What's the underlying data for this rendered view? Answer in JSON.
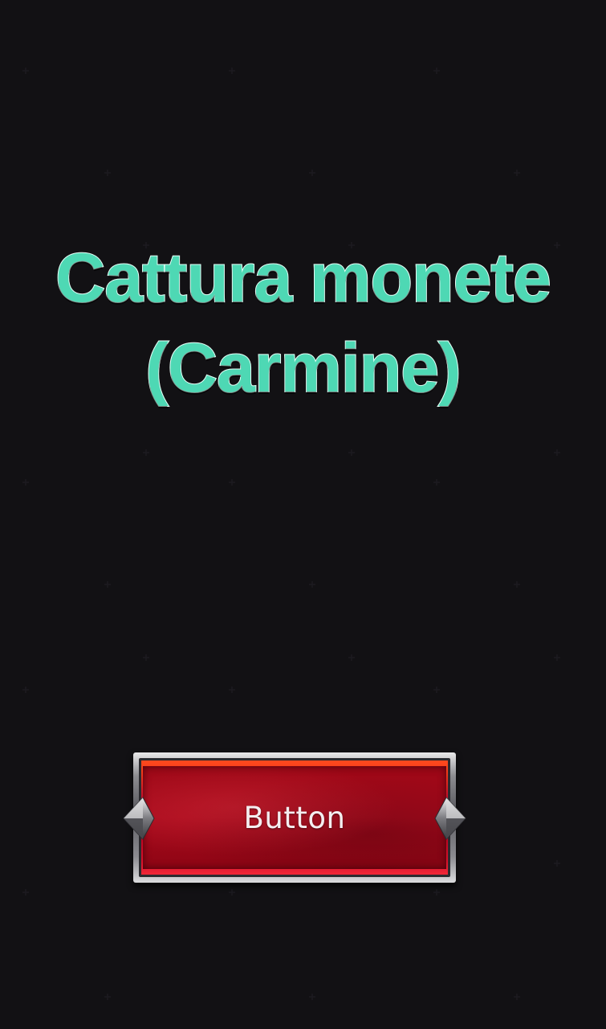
{
  "title": {
    "line1": "Cattura monete",
    "line2": "(Carmine)"
  },
  "button": {
    "label": "Button"
  },
  "colors": {
    "background": "#121114",
    "title_text": "#4ed8b4",
    "button_red": "#a80a1c",
    "frame_silver": "#8c8c90"
  }
}
